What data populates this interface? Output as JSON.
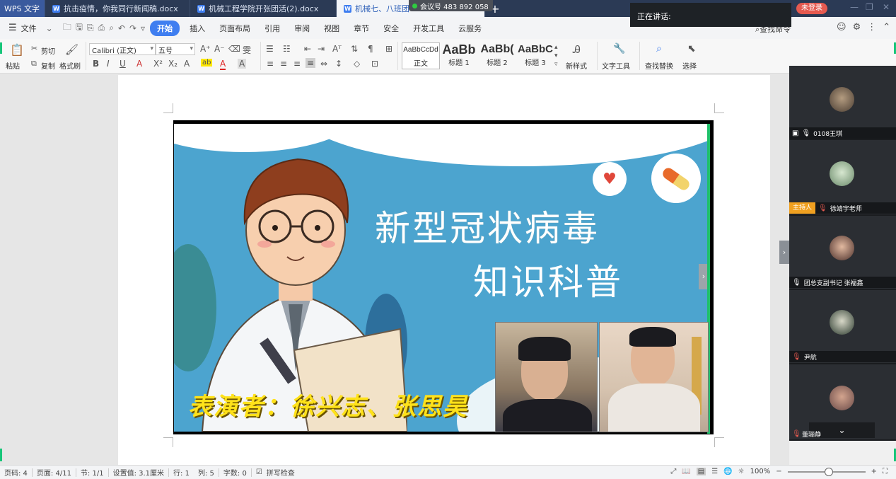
{
  "tabs": [
    {
      "label": "WPS 文字",
      "type": "app"
    },
    {
      "label": "抗击疫情，你我同行新闻稿.docx",
      "type": "doc"
    },
    {
      "label": "机械工程学院开张团活(2).docx",
      "type": "doc"
    },
    {
      "label": "机械七、八班团",
      "type": "doc",
      "active": true
    }
  ],
  "meeting": {
    "id_label": "会议号 483 892 058",
    "speaking_label": "正在讲话:"
  },
  "login_button": "未登录",
  "menu": {
    "file": "文件",
    "items": [
      "开始",
      "插入",
      "页面布局",
      "引用",
      "审阅",
      "视图",
      "章节",
      "安全",
      "开发工具",
      "云服务"
    ],
    "active": "开始",
    "search": "查找命令"
  },
  "ribbon": {
    "paste": "粘贴",
    "cut": "剪切",
    "copy": "复制",
    "format_painter": "格式刷",
    "font_name": "Calibri (正文)",
    "font_size": "五号",
    "styles": [
      {
        "preview": "AaBbCcDd",
        "name": "正文"
      },
      {
        "preview": "AaBb",
        "name": "标题 1"
      },
      {
        "preview": "AaBb(",
        "name": "标题 2"
      },
      {
        "preview": "AaBbC",
        "name": "标题 3"
      }
    ],
    "new_style": "新样式",
    "text_tools": "文字工具",
    "find_replace": "查找替换",
    "select": "选择"
  },
  "slide": {
    "title_line1": "新型冠状病毒",
    "title_line2": "知识科普",
    "performer": "表演者：徐兴志、张思昊"
  },
  "participants": [
    {
      "name": "0108王琪",
      "role": "",
      "presenting": true
    },
    {
      "name": "徐靖宇老师",
      "role": "主持人",
      "presenting": false
    },
    {
      "name": "团总支副书记 张福鑫",
      "role": "",
      "presenting": false
    },
    {
      "name": "尹航",
      "role": "",
      "presenting": false
    },
    {
      "name": "董骊静",
      "role": "",
      "presenting": false
    }
  ],
  "status": {
    "page_code": "页码: 4",
    "page": "页面: 4/11",
    "section": "节: 1/1",
    "setting": "设置值: 3.1厘米",
    "row": "行: 1",
    "col": "列: 5",
    "words": "字数: 0",
    "spell": "拼写检查",
    "zoom": "100%"
  }
}
